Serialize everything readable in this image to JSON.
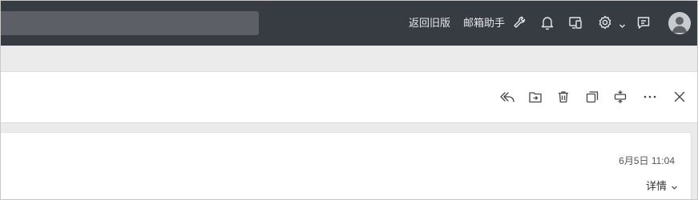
{
  "header": {
    "back_to_old": "返回旧版",
    "mail_assistant": "邮箱助手",
    "icons": [
      "wrench-icon",
      "bell-icon",
      "devices-icon",
      "gear-icon",
      "chevron-down-icon",
      "feedback-icon",
      "avatar"
    ]
  },
  "toolbar": {
    "icons": [
      "reply-all-icon",
      "move-to-folder-icon",
      "delete-icon",
      "copy-icon",
      "split-view-icon",
      "more-icon",
      "close-icon"
    ]
  },
  "message": {
    "date": "6月5日 11:04",
    "details_label": "详情"
  },
  "colors": {
    "header_bg": "#373c42",
    "search_bg": "#5c6066",
    "page_bg": "#ebebeb",
    "panel_bg": "#ffffff"
  }
}
